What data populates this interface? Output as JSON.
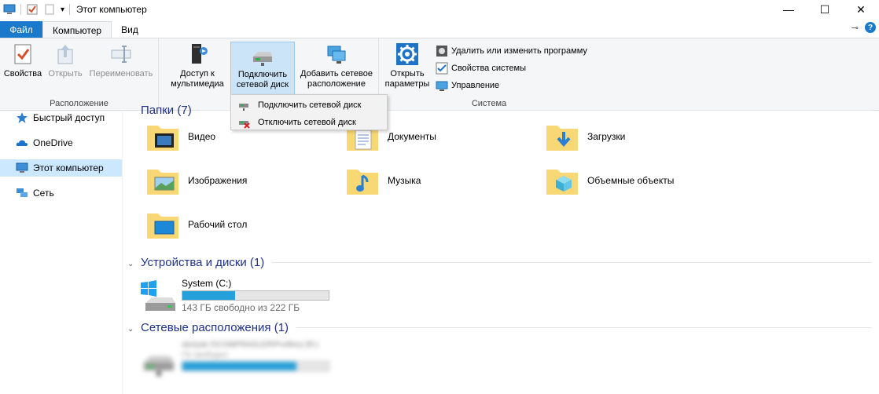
{
  "window": {
    "title": "Этот компьютер"
  },
  "window_controls": {
    "minimize": "—",
    "maximize": "☐",
    "close": "✕"
  },
  "tabs": [
    {
      "label": "Файл"
    },
    {
      "label": "Компьютер"
    },
    {
      "label": "Вид"
    }
  ],
  "ribbon": {
    "location_group": {
      "label": "Расположение",
      "properties": "Свойства",
      "open": "Открыть",
      "rename": "Переименовать"
    },
    "network_group": {
      "media_access": "Доступ к\nмультимедиа",
      "map_drive": "Подключить\nсетевой диск",
      "add_location": "Добавить сетевое\nрасположение"
    },
    "system_group": {
      "label": "Система",
      "open_settings": "Открыть\nпараметры",
      "uninstall": "Удалить или изменить программу",
      "system_properties": "Свойства системы",
      "manage": "Управление"
    }
  },
  "dropdown": {
    "items": [
      {
        "label": "Подключить сетевой диск"
      },
      {
        "label": "Отключить сетевой диск"
      }
    ]
  },
  "sidebar": {
    "items": [
      {
        "label": "Быстрый доступ"
      },
      {
        "label": "OneDrive"
      },
      {
        "label": "Этот компьютер"
      },
      {
        "label": "Сеть"
      }
    ]
  },
  "sections": {
    "folders": {
      "title": "Папки (7)"
    },
    "devices": {
      "title": "Устройства и диски (1)"
    },
    "network": {
      "title": "Сетевые расположения (1)"
    }
  },
  "folders": [
    {
      "label": "Видео"
    },
    {
      "label": "Документы"
    },
    {
      "label": "Загрузки"
    },
    {
      "label": "Изображения"
    },
    {
      "label": "Музыка"
    },
    {
      "label": "Объемные объекты"
    },
    {
      "label": "Рабочий стол"
    }
  ],
  "drives": [
    {
      "label": "System (C:)",
      "free_text": "143 ГБ свободно из 222 ГБ",
      "used_fraction": 0.36
    }
  ],
  "network_locations": [
    {
      "label": "sbclyak (\\\\COMPRASLER\\Profiles) (R:)",
      "free_text": "ГБ свободно",
      "used_fraction": 0.78
    }
  ],
  "colors": {
    "accent": "#1979ca",
    "selection": "#cce8ff",
    "bar_fill": "#26a0da",
    "section_title": "#1e3287"
  }
}
